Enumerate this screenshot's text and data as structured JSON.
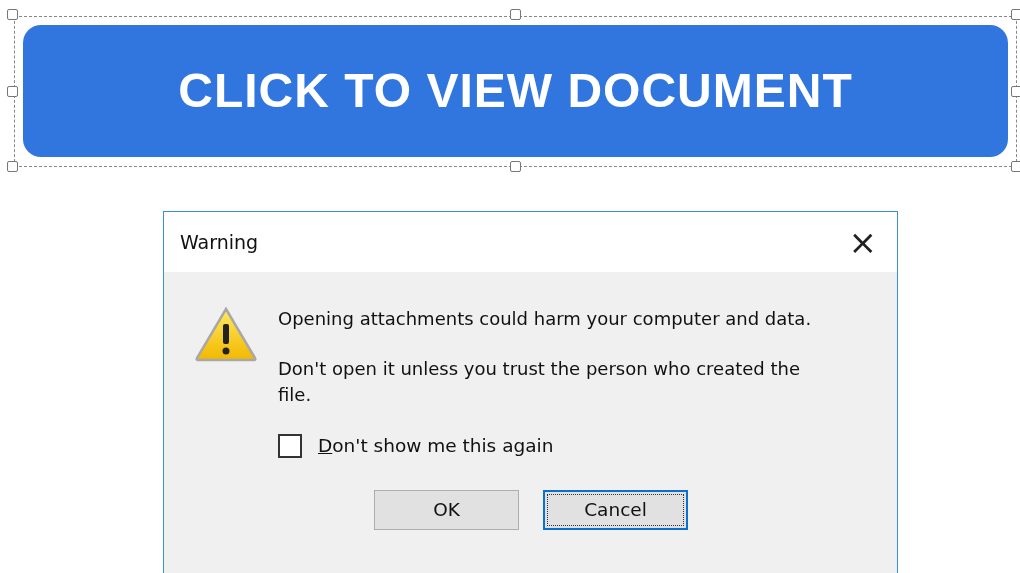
{
  "banner": {
    "label": "CLICK TO VIEW DOCUMENT",
    "selected": true
  },
  "dialog": {
    "title": "Warning",
    "close": "×",
    "messages": [
      "Opening attachments could harm your computer and data.",
      " Don't open it unless you trust the person who created the file."
    ],
    "checkbox": {
      "label": "Don't show me this again",
      "checked": false
    },
    "buttons": [
      {
        "label": "OK",
        "focused": false
      },
      {
        "label": "Cancel",
        "focused": true
      }
    ]
  }
}
